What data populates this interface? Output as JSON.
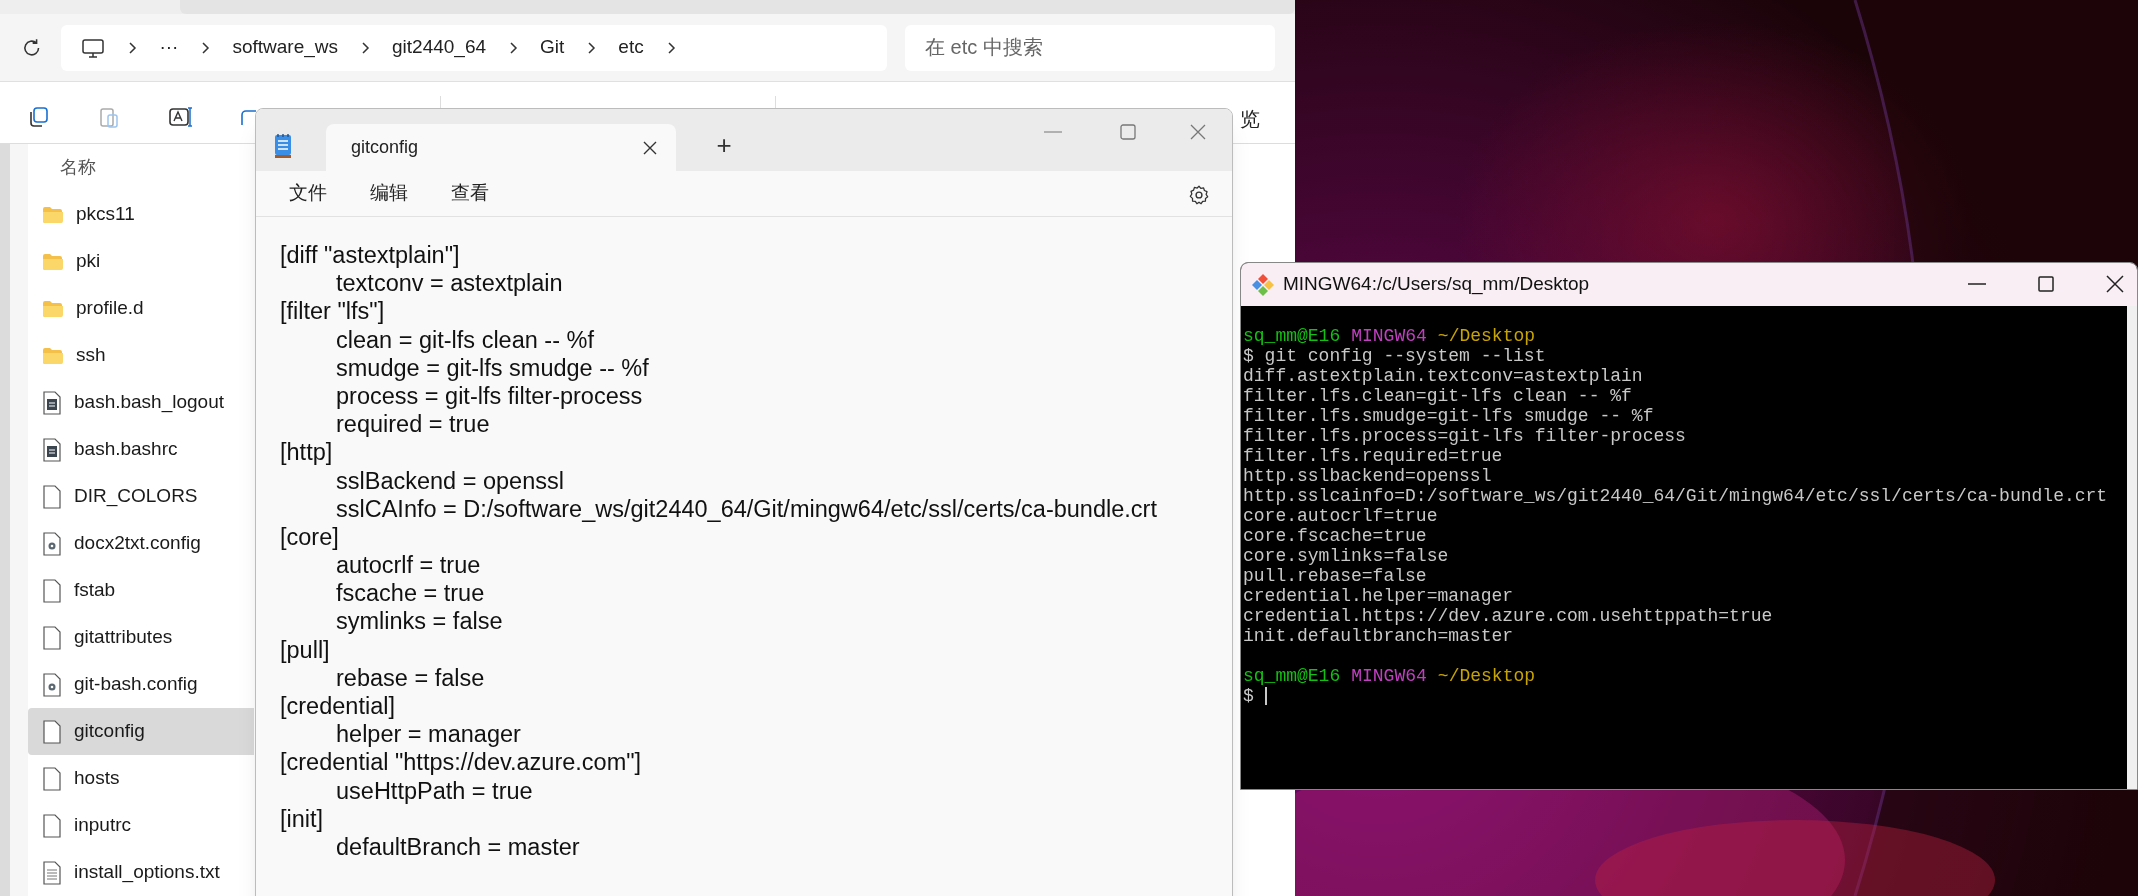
{
  "explorer": {
    "address": {
      "overflow": "···",
      "path": [
        "software_ws",
        "git2440_64",
        "Git",
        "etc"
      ]
    },
    "search": {
      "placeholder": "在 etc 中搜索"
    },
    "toolbar_label": "览",
    "column_header": "名称",
    "files": [
      {
        "name": "pkcs11",
        "kind": "folder",
        "selected": false
      },
      {
        "name": "pki",
        "kind": "folder",
        "selected": false
      },
      {
        "name": "profile.d",
        "kind": "folder",
        "selected": false
      },
      {
        "name": "ssh",
        "kind": "folder",
        "selected": false
      },
      {
        "name": "bash.bash_logout",
        "kind": "script",
        "selected": false
      },
      {
        "name": "bash.bashrc",
        "kind": "script",
        "selected": false
      },
      {
        "name": "DIR_COLORS",
        "kind": "file",
        "selected": false
      },
      {
        "name": "docx2txt.config",
        "kind": "config",
        "selected": false
      },
      {
        "name": "fstab",
        "kind": "file",
        "selected": false
      },
      {
        "name": "gitattributes",
        "kind": "file",
        "selected": false
      },
      {
        "name": "git-bash.config",
        "kind": "config",
        "selected": false
      },
      {
        "name": "gitconfig",
        "kind": "file",
        "selected": true
      },
      {
        "name": "hosts",
        "kind": "file",
        "selected": false
      },
      {
        "name": "inputrc",
        "kind": "file",
        "selected": false
      },
      {
        "name": "install_options.txt",
        "kind": "text",
        "selected": false
      }
    ]
  },
  "notepad": {
    "tab_title": "gitconfig",
    "new_tab": "+",
    "menu": [
      "文件",
      "编辑",
      "查看"
    ],
    "lines": [
      {
        "kind": "section",
        "text": "[diff \"astextplain\"]"
      },
      {
        "kind": "entry",
        "text": "textconv = astextplain"
      },
      {
        "kind": "section",
        "text": "[filter \"lfs\"]"
      },
      {
        "kind": "entry",
        "text": "clean = git-lfs clean -- %f"
      },
      {
        "kind": "entry",
        "text": "smudge = git-lfs smudge -- %f"
      },
      {
        "kind": "entry",
        "text": "process = git-lfs filter-process"
      },
      {
        "kind": "entry",
        "text": "required = true"
      },
      {
        "kind": "section",
        "text": "[http]"
      },
      {
        "kind": "entry",
        "text": "sslBackend = openssl"
      },
      {
        "kind": "entry",
        "text": "sslCAInfo = D:/software_ws/git2440_64/Git/mingw64/etc/ssl/certs/ca-bundle.crt"
      },
      {
        "kind": "section",
        "text": "[core]"
      },
      {
        "kind": "entry",
        "text": "autocrlf = true"
      },
      {
        "kind": "entry",
        "text": "fscache = true"
      },
      {
        "kind": "entry",
        "text": "symlinks = false"
      },
      {
        "kind": "section",
        "text": "[pull]"
      },
      {
        "kind": "entry",
        "text": "rebase = false"
      },
      {
        "kind": "section",
        "text": "[credential]"
      },
      {
        "kind": "entry",
        "text": "helper = manager"
      },
      {
        "kind": "section",
        "text": "[credential \"https://dev.azure.com\"]"
      },
      {
        "kind": "entry",
        "text": "useHttpPath = true"
      },
      {
        "kind": "section",
        "text": "[init]"
      },
      {
        "kind": "entry",
        "text": "defaultBranch = master"
      }
    ]
  },
  "terminal": {
    "title": "MINGW64:/c/Users/sq_mm/Desktop",
    "lines": [
      {
        "kind": "prompt",
        "user": "sq_mm@E16",
        "system": "MINGW64",
        "path": "~/Desktop"
      },
      {
        "kind": "output",
        "text": "$ git config --system --list"
      },
      {
        "kind": "output",
        "text": "diff.astextplain.textconv=astextplain"
      },
      {
        "kind": "output",
        "text": "filter.lfs.clean=git-lfs clean -- %f"
      },
      {
        "kind": "output",
        "text": "filter.lfs.smudge=git-lfs smudge -- %f"
      },
      {
        "kind": "output",
        "text": "filter.lfs.process=git-lfs filter-process"
      },
      {
        "kind": "output",
        "text": "filter.lfs.required=true"
      },
      {
        "kind": "output",
        "text": "http.sslbackend=openssl"
      },
      {
        "kind": "output",
        "text": "http.sslcainfo=D:/software_ws/git2440_64/Git/mingw64/etc/ssl/certs/ca-bundle.crt"
      },
      {
        "kind": "output",
        "text": "core.autocrlf=true"
      },
      {
        "kind": "output",
        "text": "core.fscache=true"
      },
      {
        "kind": "output",
        "text": "core.symlinks=false"
      },
      {
        "kind": "output",
        "text": "pull.rebase=false"
      },
      {
        "kind": "output",
        "text": "credential.helper=manager"
      },
      {
        "kind": "output",
        "text": "credential.https://dev.azure.com.usehttppath=true"
      },
      {
        "kind": "output",
        "text": "init.defaultbranch=master"
      },
      {
        "kind": "blank"
      },
      {
        "kind": "prompt",
        "user": "sq_mm@E16",
        "system": "MINGW64",
        "path": "~/Desktop"
      },
      {
        "kind": "input",
        "text": "$",
        "cursor": true
      }
    ]
  }
}
